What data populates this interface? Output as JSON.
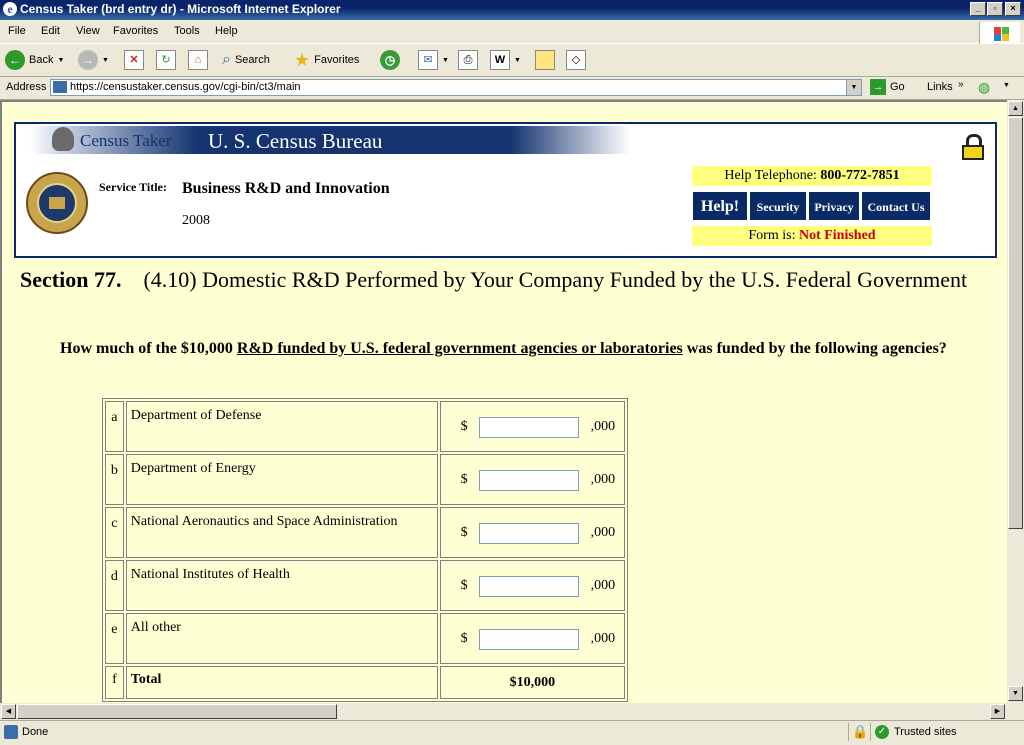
{
  "window": {
    "title": "Census Taker (brd entry dr) - Microsoft Internet Explorer",
    "minimize": "_",
    "maximize": "▫",
    "close": "×"
  },
  "menu": [
    "File",
    "Edit",
    "View",
    "Favorites",
    "Tools",
    "Help"
  ],
  "toolbar": {
    "back": "Back",
    "search": "Search",
    "favorites": "Favorites"
  },
  "address": {
    "label": "Address",
    "url": "https://censustaker.census.gov/cgi-bin/ct3/main",
    "go": "Go",
    "links": "Links"
  },
  "header": {
    "banner_left": "Census Taker",
    "banner_right": "U. S. Census Bureau",
    "service_label": "Service Title:",
    "service_title": "Business R&D and Innovation",
    "year": "2008",
    "help_tel_label": "Help Telephone:",
    "help_tel_number": "800-772-7851",
    "buttons": [
      "Help!",
      "Security",
      "Privacy",
      "Contact Us"
    ],
    "form_is_label": "Form is:",
    "form_status": "Not Finished",
    "colors": {
      "navy": "#0a2a66",
      "yellow": "#ffff80",
      "status_red": "#cc0000",
      "page_bg": "#ffffd4"
    }
  },
  "section": {
    "number": "Section 77.",
    "title": "(4.10) Domestic R&D Performed by Your Company Funded by the U.S. Federal Government"
  },
  "question": {
    "pre": "How much of the $10,000 ",
    "link": "R&D funded by U.S. federal government agencies or laboratories",
    "post": " was funded by the following agencies?"
  },
  "table": {
    "rows": [
      {
        "letter": "a",
        "label": "Department of Defense",
        "currency": "$",
        "suffix": ",000",
        "value": ""
      },
      {
        "letter": "b",
        "label": "Department of Energy",
        "currency": "$",
        "suffix": ",000",
        "value": ""
      },
      {
        "letter": "c",
        "label": "National Aeronautics and Space Administration",
        "currency": "$",
        "suffix": ",000",
        "value": ""
      },
      {
        "letter": "d",
        "label": "National Institutes of Health",
        "currency": "$",
        "suffix": ",000",
        "value": ""
      },
      {
        "letter": "e",
        "label": "All other",
        "currency": "$",
        "suffix": ",000",
        "value": ""
      }
    ],
    "total": {
      "letter": "f",
      "label": "Total",
      "value": "$10,000"
    }
  },
  "status": {
    "text": "Done",
    "zone": "Trusted sites"
  }
}
